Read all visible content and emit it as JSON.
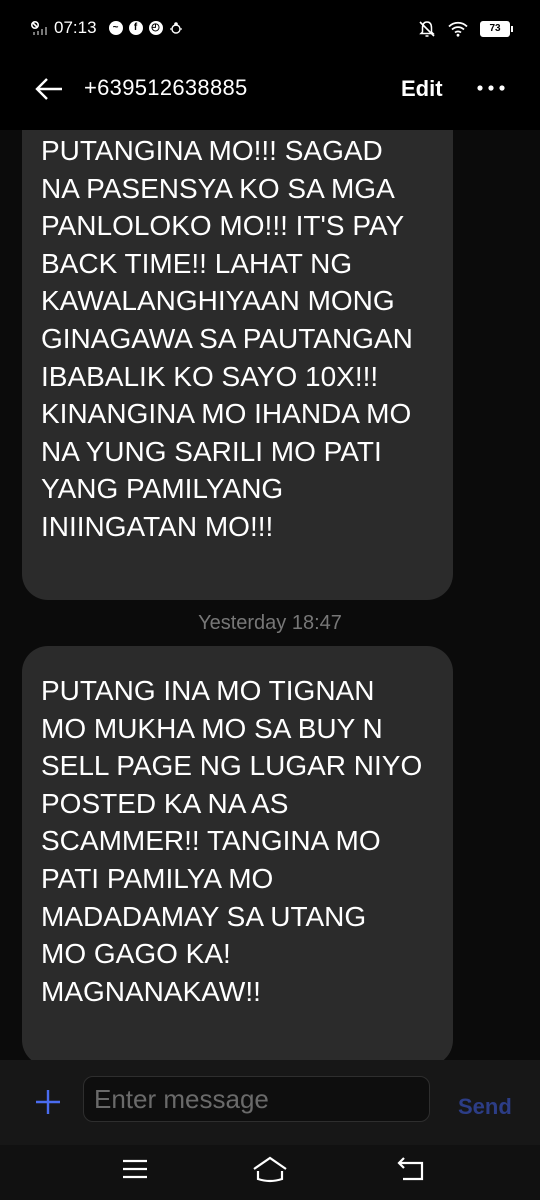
{
  "status_bar": {
    "time": "07:13",
    "battery": "73",
    "notification_icons": [
      "messenger-icon",
      "facebook-icon",
      "speedometer-icon",
      "bug-icon"
    ]
  },
  "header": {
    "title": "+639512638885",
    "edit_label": "Edit"
  },
  "messages": [
    {
      "text": "PUTANGINA MO!!! SAGAD\nNA PASENSYA KO SA MGA\nPANLOLOKO MO!!! IT'S PAY\nBACK TIME!! LAHAT NG\nKAWALANGHIYAAN MONG\nGINAGAWA SA PAUTANGAN\nIBABALIK KO SAYO 10X!!!\nKINANGINA MO IHANDA MO\nNA YUNG SARILI MO PATI\nYANG PAMILYANG\nINIINGATAN MO!!!"
    },
    {
      "text": "PUTANG INA MO TIGNAN\nMO MUKHA MO SA BUY N\nSELL PAGE NG LUGAR NIYO\nPOSTED KA NA AS\nSCAMMER!! TANGINA MO\nPATI PAMILYA MO\nMADADAMAY SA UTANG\nMO GAGO KA!\nMAGNANAKAW!!"
    }
  ],
  "timestamp": "Yesterday 18:47",
  "compose": {
    "placeholder": "Enter message",
    "send_label": "Send"
  },
  "colors": {
    "bubble": "#2b2b2b",
    "send": "#2c3d86",
    "add_icon": "#4a6cf0"
  }
}
